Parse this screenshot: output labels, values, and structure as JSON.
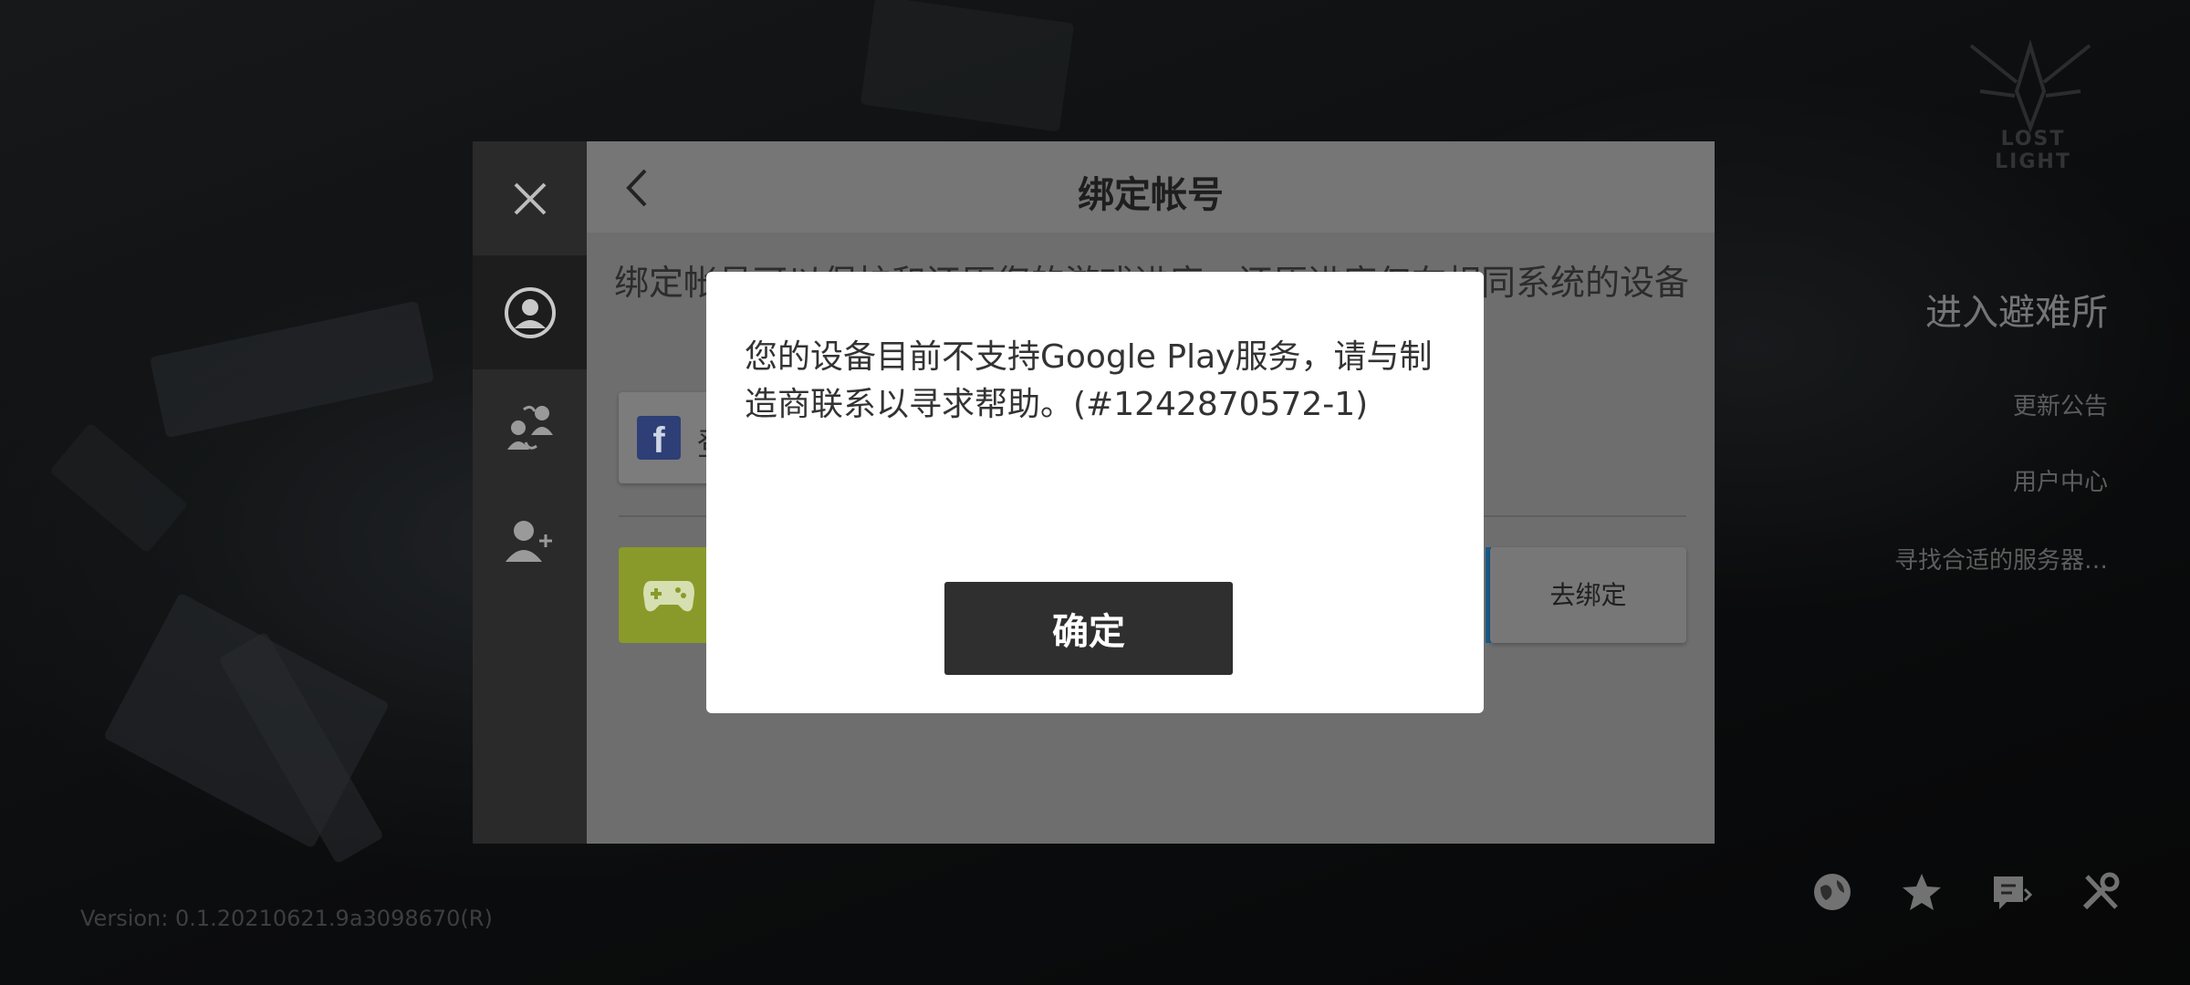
{
  "background": {
    "logo_text": "LOST LIGHT",
    "right_menu": {
      "enter_shelter": "进入避难所",
      "announcement": "更新公告",
      "user_center": "用户中心",
      "find_server": "寻找合适的服务器…"
    },
    "version": "Version: 0.1.20210621.9a3098670(R)",
    "bottom_icons": [
      "globe-icon",
      "star-icon",
      "feedback-icon",
      "tools-icon"
    ]
  },
  "bind_panel": {
    "title": "绑定帐号",
    "description": "绑定帐号可以保护和还原您的游戏进度，还原进度仅在相同系统的设备",
    "facebook_label": "登",
    "unbind_label": "去绑定",
    "side_icons": [
      "close-icon",
      "user-icon",
      "switch-account-icon",
      "add-user-icon"
    ]
  },
  "dialog": {
    "message": "您的设备目前不支持Google Play服务，请与制造商联系以寻求帮助。(#1242870572-1)",
    "confirm_label": "确定"
  },
  "colors": {
    "dialog_bg": "#ffffff",
    "confirm_bg": "#2f2f2f",
    "google_play_tile": "#8a9a2a",
    "facebook_blue": "#3b5998"
  }
}
